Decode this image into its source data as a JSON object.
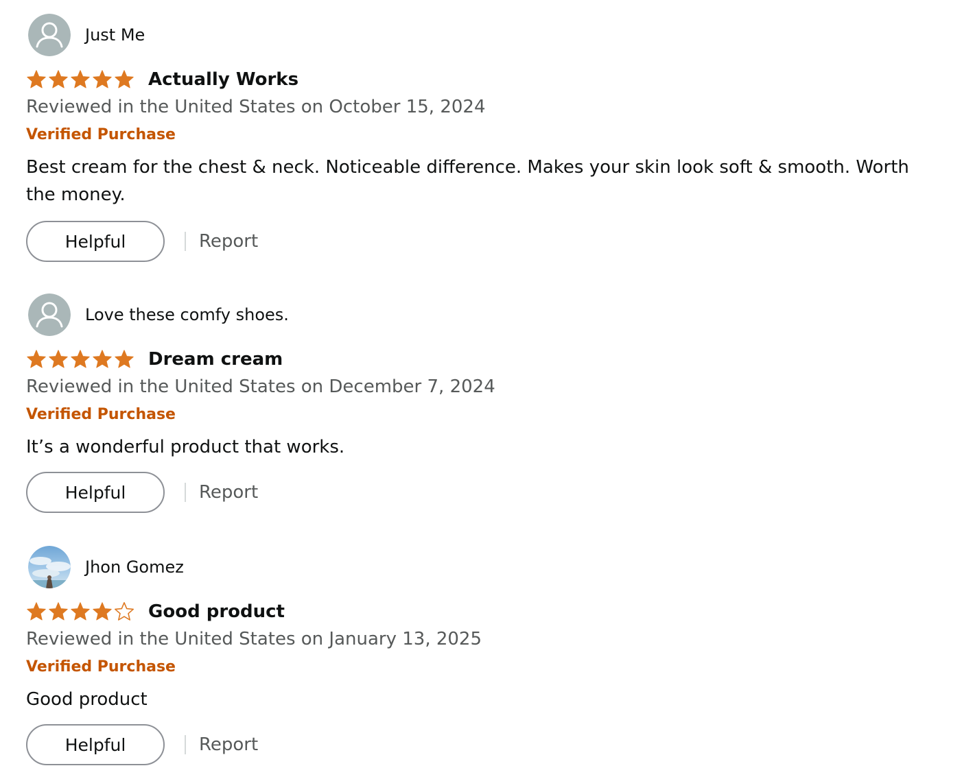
{
  "reviews": [
    {
      "profile_name": "Just Me",
      "avatar": "default-user-icon",
      "rating": 5,
      "rating_max": 5,
      "title": "Actually Works",
      "date_text": "Reviewed in the United States on October 15, 2024",
      "verified_label": "Verified Purchase",
      "body": "Best cream for the chest & neck. Noticeable difference. Makes your skin look soft & smooth. Worth the money.",
      "helpful_label": "Helpful",
      "report_label": "Report"
    },
    {
      "profile_name": "Love these comfy shoes.",
      "avatar": "default-user-icon",
      "rating": 5,
      "rating_max": 5,
      "title": "Dream cream",
      "date_text": "Reviewed in the United States on December 7, 2024",
      "verified_label": "Verified Purchase",
      "body": "It’s a wonderful product that works.",
      "helpful_label": "Helpful",
      "report_label": "Report"
    },
    {
      "profile_name": "Jhon Gomez",
      "avatar": "sky-photo-avatar",
      "rating": 4,
      "rating_max": 5,
      "title": "Good product",
      "date_text": "Reviewed in the United States on January 13, 2025",
      "verified_label": "Verified Purchase",
      "body": "Good product",
      "helpful_label": "Helpful",
      "report_label": "Report"
    }
  ],
  "colors": {
    "star_fill": "#de7921",
    "verified": "#c45500",
    "secondary_text": "#565959",
    "avatar_bg": "#aab7b8"
  }
}
